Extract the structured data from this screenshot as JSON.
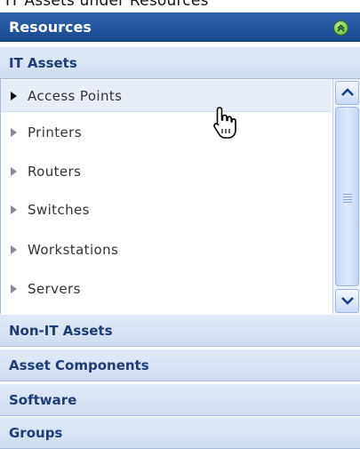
{
  "top_cut_text": "IT Assets under Resources",
  "header": {
    "title": "Resources",
    "collapse_icon": "double-chevron-up-icon"
  },
  "sections": {
    "it_assets": "IT Assets",
    "non_it_assets": "Non-IT Assets",
    "asset_components": "Asset Components",
    "software": "Software",
    "groups": "Groups"
  },
  "items": [
    {
      "label": "Access Points",
      "selected": true
    },
    {
      "label": "Printers"
    },
    {
      "label": "Routers"
    },
    {
      "label": "Switches"
    },
    {
      "label": "Workstations"
    },
    {
      "label": "Servers"
    }
  ],
  "colors": {
    "header": "#2457a0",
    "section_bg": "#d7e2f3",
    "section_text": "#1f3c73",
    "selected_bg": "#e8eef8"
  }
}
